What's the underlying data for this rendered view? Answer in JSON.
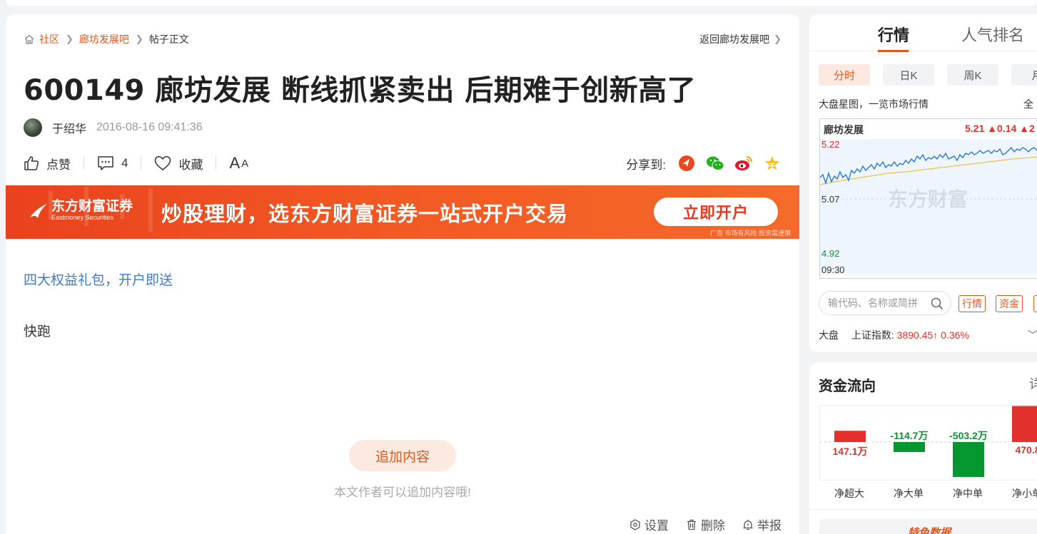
{
  "breadcrumb": {
    "home": "社区",
    "forum": "廊坊发展吧",
    "current": "帖子正文",
    "back": "返回廊坊发展吧"
  },
  "post": {
    "title": "600149 廊坊发展 断线抓紧卖出 后期难于创新高了",
    "author": "于绍华",
    "time": "2016-08-16 09:41:36",
    "promo_link": "四大权益礼包，开户即送",
    "body": "快跑"
  },
  "toolbar": {
    "like": "点赞",
    "comment_count": "4",
    "favorite": "收藏",
    "font_big": "A",
    "font_small": "A",
    "share_label": "分享到:"
  },
  "banner": {
    "logo_cn": "东方财富证券",
    "logo_en": "Eastmoney Securities",
    "slogan": "炒股理财，选东方财富证券一站式开户交易",
    "button": "立即开户",
    "ad_tag": "广告 市场有风险 投资需谨慎"
  },
  "append": {
    "button": "追加内容",
    "tip": "本文作者可以追加内容哦!"
  },
  "actions": {
    "settings": "设置",
    "delete": "删除",
    "report": "举报"
  },
  "market": {
    "tabs": [
      "行情",
      "人气排名"
    ],
    "ktabs": [
      "分时",
      "日K",
      "周K",
      "月"
    ],
    "chart_desc": "大盘星图，一览市场行情",
    "chart_more": "全",
    "stock_name": "廊坊发展",
    "price_line": "5.21 ▲0.14 ▲2",
    "y_high": "5.22",
    "y_mid": "5.07",
    "y_low": "4.92",
    "x_start": "09:30",
    "watermark": "东方财富",
    "search_placeholder": "输代码、名称或简拼",
    "quick_buttons": [
      "行情",
      "资金"
    ],
    "index_label": "大盘",
    "index_name": "上证指数:",
    "index_value": "3890.45↑  0.36%",
    "colors": {
      "up": "#e4302c",
      "down": "#06962f",
      "accent": "#e0581d"
    }
  },
  "fund_flow": {
    "title": "资金流向",
    "more": "详",
    "special": "特色数据",
    "chart_data": {
      "type": "bar",
      "categories": [
        "净超大",
        "净大单",
        "净中单",
        "净小单"
      ],
      "values": [
        147.1,
        -114.7,
        -503.2,
        470.8
      ],
      "labels": [
        "147.1万",
        "-114.7万",
        "-503.2万",
        "470.8"
      ],
      "unit": "万"
    }
  }
}
